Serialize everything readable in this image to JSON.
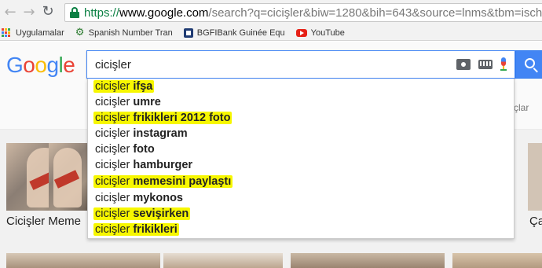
{
  "browser": {
    "url_https": "https://",
    "url_host": "www.google.com",
    "url_path": "/search?q=cicişler&biw=1280&bih=643&source=lnms&tbm=isch"
  },
  "bookmarks": [
    {
      "label": "Uygulamalar",
      "icon": "apps-grid-icon"
    },
    {
      "label": "Spanish Number Tran",
      "icon": "gear-icon"
    },
    {
      "label": "BGFIBank Guinée Equ",
      "icon": "bank-icon"
    },
    {
      "label": "YouTube",
      "icon": "youtube-icon"
    }
  ],
  "google": {
    "logo": "Google",
    "query": "cicişler",
    "tools_partial": "çlar"
  },
  "suggestions": [
    {
      "prefix": "cicişler ",
      "bold": "ifşa",
      "highlighted": true
    },
    {
      "prefix": "cicişler ",
      "bold": "umre",
      "highlighted": false
    },
    {
      "prefix": "cicişler ",
      "bold": "frikikleri 2012 foto",
      "highlighted": true
    },
    {
      "prefix": "cicişler ",
      "bold": "instagram",
      "highlighted": false
    },
    {
      "prefix": "cicişler ",
      "bold": "foto",
      "highlighted": false
    },
    {
      "prefix": "cicişler ",
      "bold": "hamburger",
      "highlighted": false
    },
    {
      "prefix": "cicişler ",
      "bold": "memesini paylaştı",
      "highlighted": true
    },
    {
      "prefix": "cicişler ",
      "bold": "mykonos",
      "highlighted": false
    },
    {
      "prefix": "cicişler ",
      "bold": "sevişirken",
      "highlighted": true
    },
    {
      "prefix": "cicişler ",
      "bold": "frikikleri",
      "highlighted": true
    }
  ],
  "results": {
    "first_label": "Cicişler Meme",
    "right_label": "Ça"
  },
  "colors": {
    "highlight": "#f7f700",
    "google_blue": "#4285f4",
    "google_red": "#ea4335",
    "google_yellow": "#fbbc05",
    "google_green": "#34a853"
  }
}
